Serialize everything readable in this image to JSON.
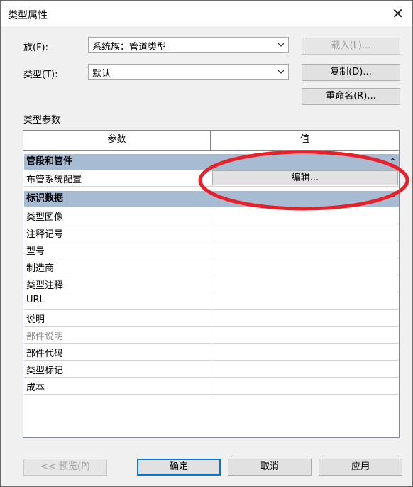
{
  "window": {
    "title": "类型属性",
    "close_glyph": "✕"
  },
  "family": {
    "label": "族(F):",
    "value": "系统族：管道类型",
    "load_button": "载入(L)..."
  },
  "type": {
    "label": "类型(T):",
    "value": "默认",
    "duplicate_button": "复制(D)...",
    "rename_button": "重命名(R)..."
  },
  "section": {
    "label": "类型参数"
  },
  "grid": {
    "col_param": "参数",
    "col_value": "值",
    "group1": {
      "label": "管段和管件",
      "caret": "⌃"
    },
    "routing_row": {
      "name": "布管系统配置",
      "edit_button": "编辑..."
    },
    "group2": {
      "label": "标识数据",
      "caret": "⌃"
    },
    "rows": [
      "类型图像",
      "注释记号",
      "型号",
      "制造商",
      "类型注释",
      "URL",
      "说明",
      "部件说明",
      "部件代码",
      "类型标记",
      "成本"
    ]
  },
  "footer": {
    "preview_button": "<< 预览(P)",
    "ok_button": "确定",
    "cancel_button": "取消",
    "apply_button": "应用"
  },
  "colors": {
    "accent": "#0078d7",
    "group_header": "#a7bbd3",
    "annotation": "#e8202a"
  }
}
